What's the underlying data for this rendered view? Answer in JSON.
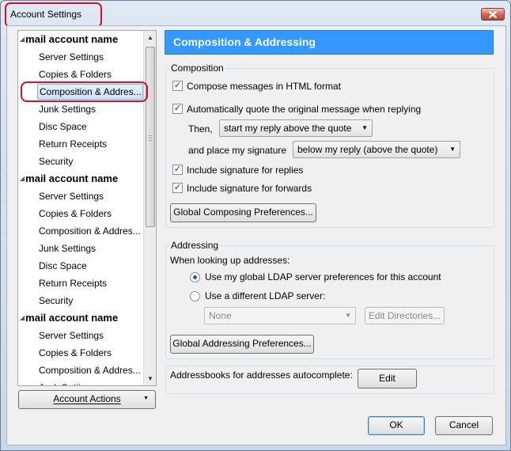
{
  "window": {
    "title": "Account Settings",
    "close_icon": "close-icon"
  },
  "tree": {
    "accounts": [
      {
        "name": "mail account name",
        "items": [
          "Server Settings",
          "Copies & Folders",
          "Composition & Addres...",
          "Junk Settings",
          "Disc Space",
          "Return Receipts",
          "Security"
        ]
      },
      {
        "name": "mail account name",
        "items": [
          "Server Settings",
          "Copies & Folders",
          "Composition & Addres...",
          "Junk Settings",
          "Disc Space",
          "Return Receipts",
          "Security"
        ]
      },
      {
        "name": "mail account name",
        "items": [
          "Server Settings",
          "Copies & Folders",
          "Composition & Addres...",
          "Junk Settings"
        ]
      }
    ],
    "selected": "Composition & Addres..."
  },
  "account_actions": {
    "label": "Account Actions"
  },
  "header": {
    "title": "Composition & Addressing"
  },
  "composition": {
    "group_label": "Composition",
    "html_format": {
      "label": "Compose messages in HTML format",
      "checked": true
    },
    "auto_quote": {
      "label": "Automatically quote the original message when replying",
      "checked": true
    },
    "then_label": "Then,",
    "then_select": "start my reply above the quote",
    "signature_label": "and place my signature",
    "signature_select": "below my reply (above the quote)",
    "sig_replies": {
      "label": "Include signature for replies",
      "checked": true
    },
    "sig_forwards": {
      "label": "Include signature for forwards",
      "checked": true
    },
    "global_composing_button": "Global Composing Preferences..."
  },
  "addressing": {
    "group_label": "Addressing",
    "lookup_label": "When looking up addresses:",
    "use_global": {
      "label": "Use my global LDAP server preferences for this account",
      "selected": true
    },
    "use_different": {
      "label": "Use a different LDAP server:",
      "selected": false
    },
    "server_select": "None",
    "edit_directories_button": "Edit Directories...",
    "global_addressing_button": "Global Addressing Preferences..."
  },
  "autocomplete": {
    "label": "Addressbooks for addresses autocomplete:",
    "edit_button": "Edit"
  },
  "footer": {
    "ok_button": "OK",
    "cancel_button": "Cancel"
  },
  "colors": {
    "header_bg": "#3399ff",
    "annotation_red": "#d8102a"
  }
}
